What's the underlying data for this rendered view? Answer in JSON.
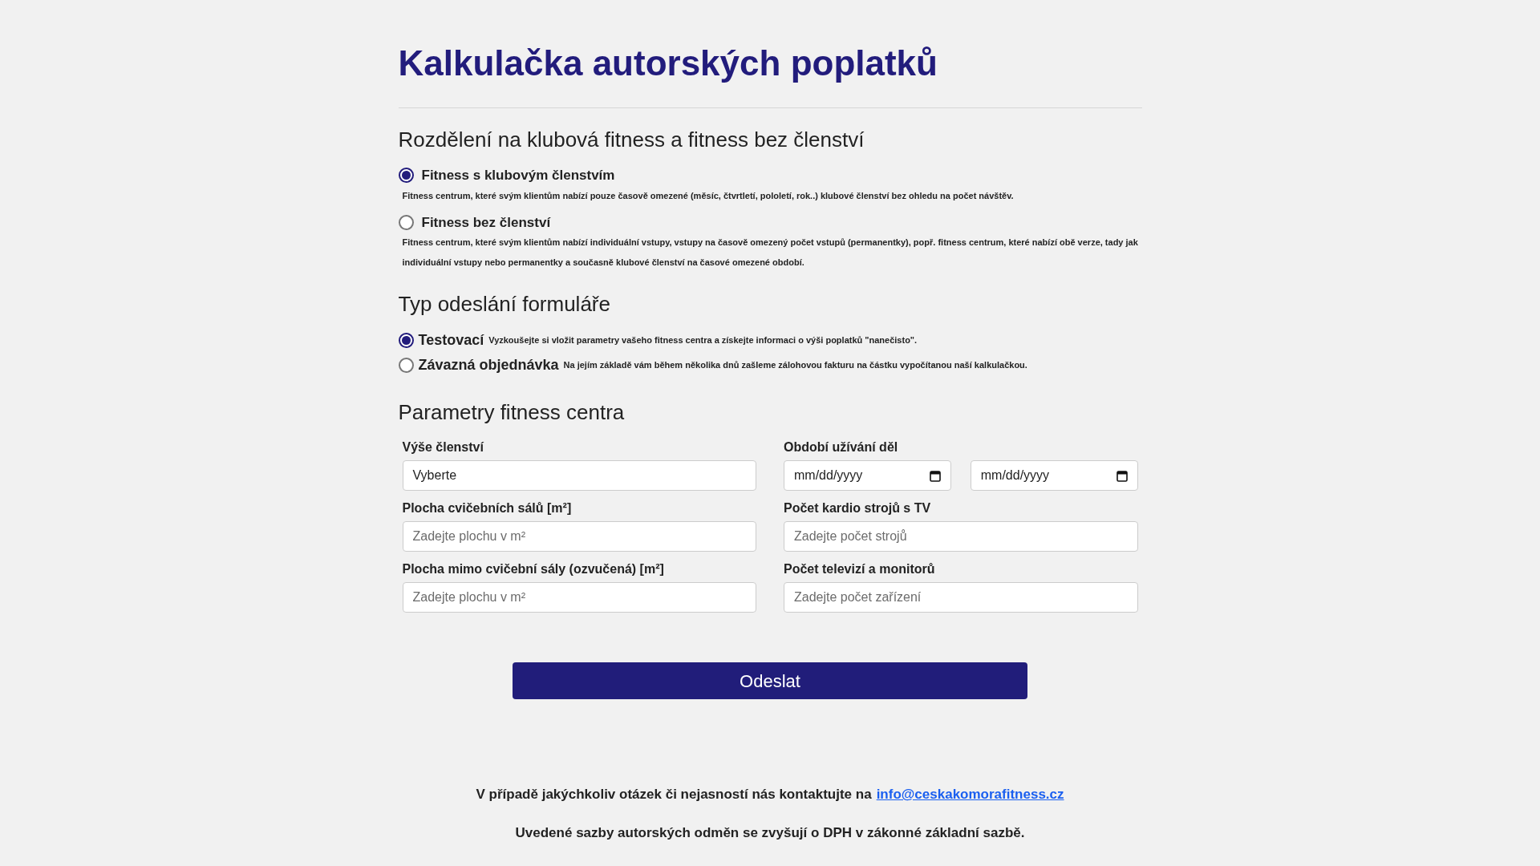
{
  "title": "Kalkulačka autorských poplatků",
  "membership_section": {
    "heading": "Rozdělení na klubová fitness a fitness bez členství",
    "options": [
      {
        "label": "Fitness s klubovým členstvím",
        "selected": true,
        "description": "Fitness centrum, které svým klientům nabízí pouze časově omezené (měsíc, čtvrtletí, pololetí, rok..) klubové členství bez ohledu na počet návštěv."
      },
      {
        "label": "Fitness bez členství",
        "selected": false,
        "description": "Fitness centrum, které svým klientům nabízí individuální vstupy, vstupy na časově omezený počet vstupů (permanentky), popř. fitness centrum, které nabízí obě verze, tady jak individuální vstupy nebo permanentky a současně klubové členství na časové omezené období."
      }
    ]
  },
  "submission_section": {
    "heading": "Typ odeslání formuláře",
    "options": [
      {
        "label": "Testovací",
        "selected": true,
        "description": "Vyzkoušejte si vložit parametry vašeho fitness centra a získejte informaci o výši poplatků \"nanečisto\"."
      },
      {
        "label": "Závazná objednávka",
        "selected": false,
        "description": "Na jejím základě vám během několika dnů zašleme zálohovou fakturu na částku vypočítanou naší kalkulačkou."
      }
    ]
  },
  "parameters_section": {
    "heading": "Parametry fitness centra",
    "fields": [
      {
        "kind": "select",
        "label": "Výše členství",
        "value": "Vyberte"
      },
      {
        "kind": "daterange",
        "label": "Období užívání děl",
        "placeholders": [
          "mm/dd/yyyy",
          "mm/dd/yyyy"
        ]
      },
      {
        "kind": "text",
        "label": "Plocha cvičebních sálů [m²]",
        "placeholder": "Zadejte plochu v m²"
      },
      {
        "kind": "text",
        "label": "Počet kardio strojů s TV",
        "placeholder": "Zadejte počet strojů"
      },
      {
        "kind": "text",
        "label": "Plocha mimo cvičební sály (ozvučená) [m²]",
        "placeholder": "Zadejte plochu v m²"
      },
      {
        "kind": "text",
        "label": "Počet televizí a monitorů",
        "placeholder": "Zadejte počet zařízení"
      }
    ]
  },
  "submit_button": "Odeslat",
  "footer": {
    "contact_text": "V případě jakýchkoliv otázek či nejasností nás kontaktujte na",
    "email": "info@ceskakomorafitness.cz",
    "note": "Uvedené sazby autorských odměn se zvyšují o DPH v zákonné základní sazbě."
  }
}
